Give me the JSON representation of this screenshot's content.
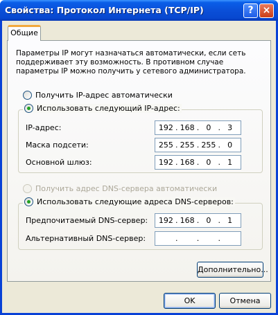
{
  "window": {
    "title": "Свойства: Протокол Интернета (TCP/IP)",
    "help_label": "?",
    "close_label": "×"
  },
  "tabs": [
    {
      "label": "Общие",
      "selected": true
    }
  ],
  "description": "Параметры IP могут назначаться автоматически, если сеть поддерживает эту возможность. В противном случае параметры IP можно получить у сетевого администратора.",
  "ip_section": {
    "auto_label": "Получить IP-адрес автоматически",
    "auto_selected": false,
    "manual_label": "Использовать следующий IP-адрес:",
    "manual_selected": true,
    "fields": [
      {
        "label": "IP-адрес:",
        "octets": [
          "192",
          "168",
          "0",
          "3"
        ]
      },
      {
        "label": "Маска подсети:",
        "octets": [
          "255",
          "255",
          "255",
          "0"
        ]
      },
      {
        "label": "Основной шлюз:",
        "octets": [
          "192",
          "168",
          "0",
          "1"
        ]
      }
    ]
  },
  "dns_section": {
    "auto_label": "Получить адрес DNS-сервера автоматически",
    "auto_enabled": false,
    "manual_label": "Использовать следующие адреса DNS-серверов:",
    "manual_selected": true,
    "fields": [
      {
        "label": "Предпочитаемый DNS-сервер:",
        "octets": [
          "192",
          "168",
          "0",
          "1"
        ]
      },
      {
        "label": "Альтернативный DNS-сервер:",
        "octets": [
          "",
          "",
          "",
          ""
        ]
      }
    ]
  },
  "buttons": {
    "advanced": "Дополнительно...",
    "ok": "OK",
    "cancel": "Отмена"
  },
  "colors": {
    "titlebar": "#0a4fd8",
    "dialog_bg": "#ece9d8",
    "radio_dot": "#21a121",
    "tab_highlight": "#f2a83c"
  }
}
